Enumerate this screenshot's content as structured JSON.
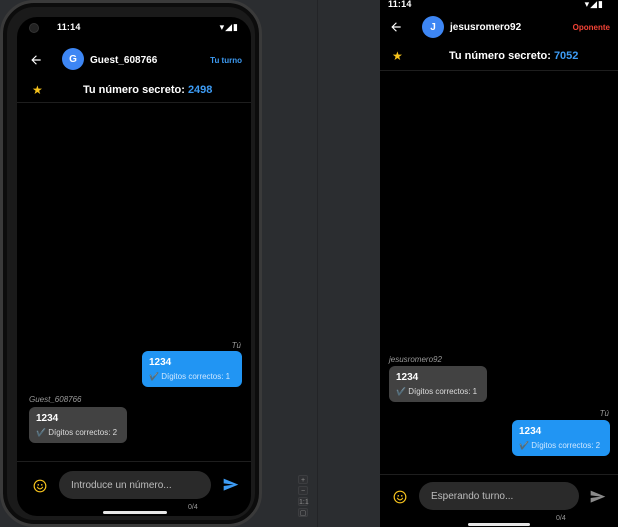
{
  "left_device": {
    "status": {
      "time": "11:14",
      "icons": "▾◢▮"
    },
    "appbar": {
      "avatar_letter": "G",
      "player_name": "Guest_608766",
      "turn_label": "Tu turno",
      "turn_color": "#3d9bf3"
    },
    "secret": {
      "label": "Tu número secreto:",
      "number": "2498"
    },
    "messages": [
      {
        "sender": "Tú",
        "guess": "1234",
        "result": "Dígitos correctos: 1",
        "mine": true
      },
      {
        "sender": "Guest_608766",
        "guess": "1234",
        "result": "Dígitos correctos: 2",
        "mine": false
      }
    ],
    "input": {
      "placeholder": "Introduce un número...",
      "counter": "0/4"
    }
  },
  "right_device": {
    "status": {
      "time": "11:14",
      "icons": "▾◢▮"
    },
    "appbar": {
      "avatar_letter": "J",
      "player_name": "jesusromero92",
      "turn_label": "Oponente",
      "turn_color": "#f44336"
    },
    "secret": {
      "label": "Tu número secreto:",
      "number": "7052"
    },
    "messages": [
      {
        "sender": "jesusromero92",
        "guess": "1234",
        "result": "Dígitos correctos: 1",
        "mine": false
      },
      {
        "sender": "Tú",
        "guess": "1234",
        "result": "Dígitos correctos: 2",
        "mine": true
      }
    ],
    "input": {
      "placeholder": "Esperando turno...",
      "counter": "0/4"
    }
  },
  "emulator_toolbar": [
    "+",
    "−",
    "1:1",
    "▢"
  ],
  "check_mark": "✔️",
  "colors": {
    "accent_blue": "#2195f3",
    "star": "#f7c31c",
    "opponent_red": "#f44336"
  }
}
